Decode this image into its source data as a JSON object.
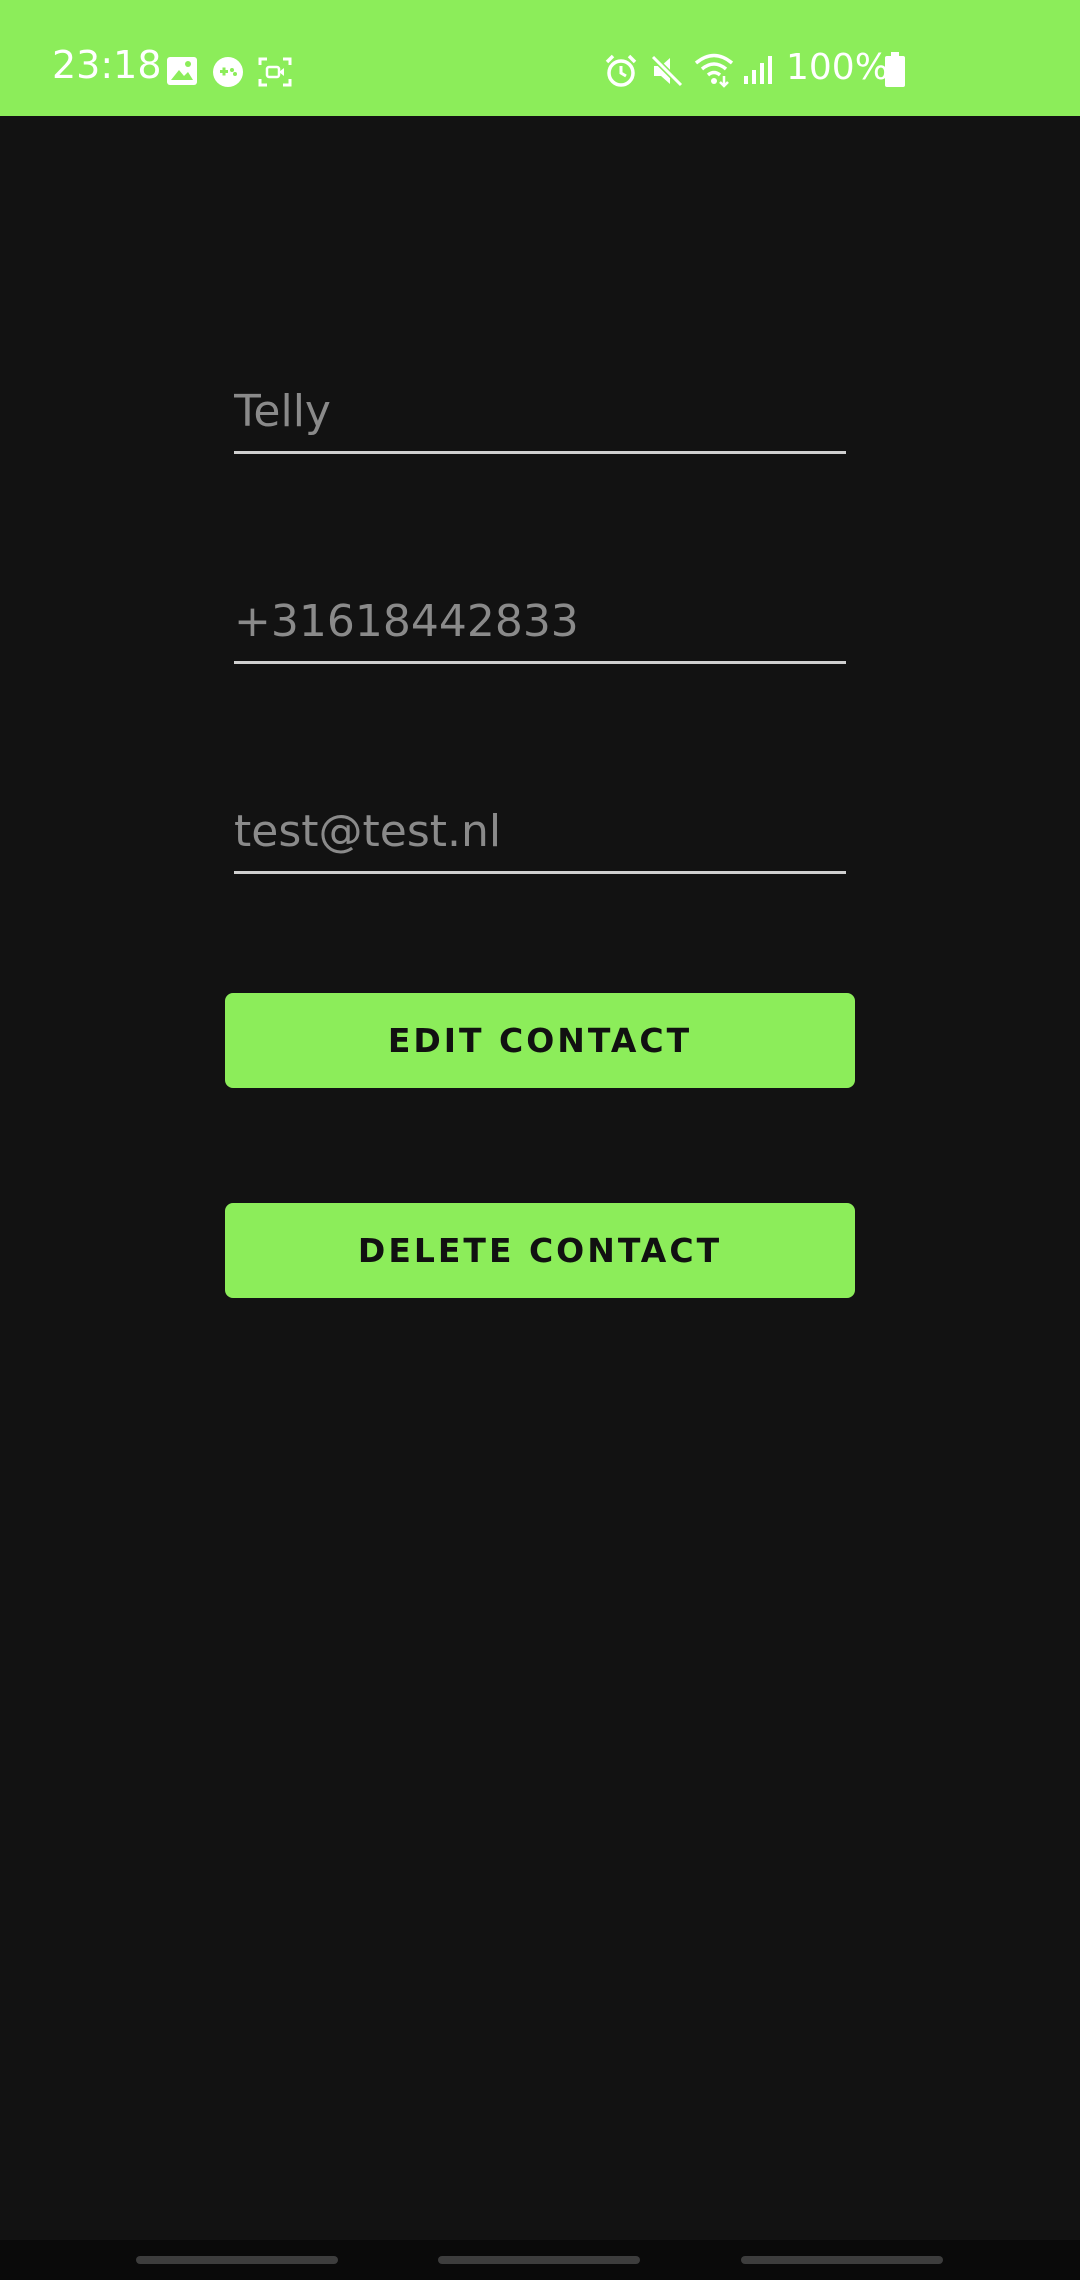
{
  "status_bar": {
    "time": "23:18",
    "battery": "100%",
    "background_color": "#8ced5a",
    "left_icons": [
      "gallery-icon",
      "game-controller-icon",
      "screen-record-icon"
    ],
    "right_icons": [
      "alarm-icon",
      "mute-icon",
      "wifi-icon",
      "signal-icon",
      "battery-icon"
    ]
  },
  "form": {
    "name_value": "Telly",
    "phone_value": "+31618442833",
    "email_value": "test@test.nl"
  },
  "buttons": {
    "edit_label": "EDIT CONTACT",
    "delete_label": "DELETE CONTACT",
    "color": "#8ced5a"
  },
  "nav_bar": {
    "handles": [
      "recents-handle",
      "home-handle",
      "back-handle"
    ]
  }
}
